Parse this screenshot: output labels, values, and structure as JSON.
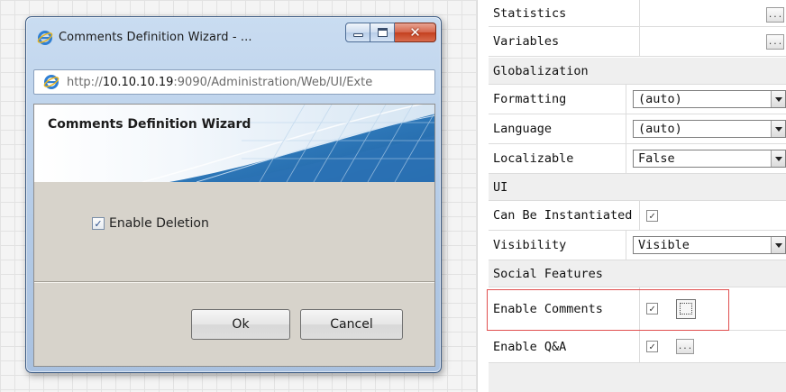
{
  "window": {
    "title": "Comments Definition Wizard - ...",
    "url_scheme": "http://",
    "url_host": "10.10.10.19",
    "url_rest": ":9090/Administration/Web/UI/Exte"
  },
  "dialog": {
    "heading": "Comments Definition Wizard",
    "enable_deletion_label": "Enable Deletion",
    "enable_deletion_checked": true,
    "ok_label": "Ok",
    "cancel_label": "Cancel"
  },
  "property_grid": {
    "rows_top": [
      {
        "label": "Statistics",
        "ellipsis": "..."
      },
      {
        "label": "Variables",
        "ellipsis": "..."
      }
    ],
    "categories": {
      "globalization": "Globalization",
      "ui": "UI",
      "social": "Social Features"
    },
    "globalization_rows": [
      {
        "label": "Formatting",
        "value": "(auto)"
      },
      {
        "label": "Language",
        "value": "(auto)"
      },
      {
        "label": "Localizable",
        "value": "False"
      }
    ],
    "ui_rows": {
      "can_be_instantiated": {
        "label": "Can Be Instantiated",
        "checked": true
      },
      "visibility": {
        "label": "Visibility",
        "value": "Visible"
      }
    },
    "social_rows": {
      "enable_comments": {
        "label": "Enable Comments",
        "checked": true
      },
      "enable_qa": {
        "label": "Enable Q&A",
        "checked": true,
        "ellipsis": "..."
      }
    },
    "check_glyph": "✓",
    "highlight_color": "#e05050"
  }
}
